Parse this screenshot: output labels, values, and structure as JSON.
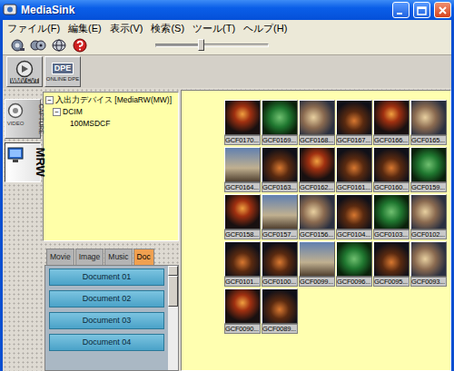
{
  "window": {
    "title": "MediaSink"
  },
  "menu": [
    "ファイル(F)",
    "編集(E)",
    "表示(V)",
    "検索(S)",
    "ツール(T)",
    "ヘルプ(H)"
  ],
  "toolbar": {
    "zoom": {
      "level": 0.4
    }
  },
  "tools": [
    {
      "label": "WMV CVT",
      "kind": "convert"
    },
    {
      "label": "DPE",
      "sublabel": "ONLINE DPE",
      "kind": "online"
    }
  ],
  "side_tabs": [
    {
      "icon_text": "VIDEO",
      "label": "CAPTURE",
      "kind": "capture",
      "selected": false
    },
    {
      "label": "MRW",
      "kind": "mrw",
      "selected": true
    }
  ],
  "tree": {
    "label": "入出力デバイス [MediaRW(MW)]",
    "expander": "−",
    "expanded": true,
    "children": [
      {
        "label": "DCIM",
        "expander": "−",
        "expanded": true,
        "children": [
          {
            "label": "100MSDCF"
          }
        ]
      }
    ]
  },
  "media_tabs": [
    {
      "label": "Movie",
      "selected": false
    },
    {
      "label": "Image",
      "selected": false
    },
    {
      "label": "Music",
      "selected": false
    },
    {
      "label": "Doc",
      "selected": true
    }
  ],
  "documents": [
    "Document 01",
    "Document 02",
    "Document 03",
    "Document 04"
  ],
  "thumbnails": [
    {
      "caption": "GCF0170..."
    },
    {
      "caption": "GCF0169..."
    },
    {
      "caption": "GCF0168..."
    },
    {
      "caption": "GCF0167..."
    },
    {
      "caption": "GCF0166..."
    },
    {
      "caption": "GCF0165..."
    },
    {
      "caption": "GCF0164..."
    },
    {
      "caption": "GCF0163..."
    },
    {
      "caption": "GCF0162..."
    },
    {
      "caption": "GCF0161..."
    },
    {
      "caption": "GCF0160..."
    },
    {
      "caption": "GCF0159..."
    },
    {
      "caption": "GCF0158..."
    },
    {
      "caption": "GCF0157..."
    },
    {
      "caption": "GCF0156..."
    },
    {
      "caption": "GCF0104..."
    },
    {
      "caption": "GCF0103..."
    },
    {
      "caption": "GCF0102..."
    },
    {
      "caption": "GCF0101..."
    },
    {
      "caption": "GCF0100..."
    },
    {
      "caption": "GCF0099..."
    },
    {
      "caption": "GCF0096..."
    },
    {
      "caption": "GCF0095..."
    },
    {
      "caption": "GCF0093..."
    },
    {
      "caption": "GCF0090..."
    },
    {
      "caption": "GCF0089..."
    }
  ]
}
